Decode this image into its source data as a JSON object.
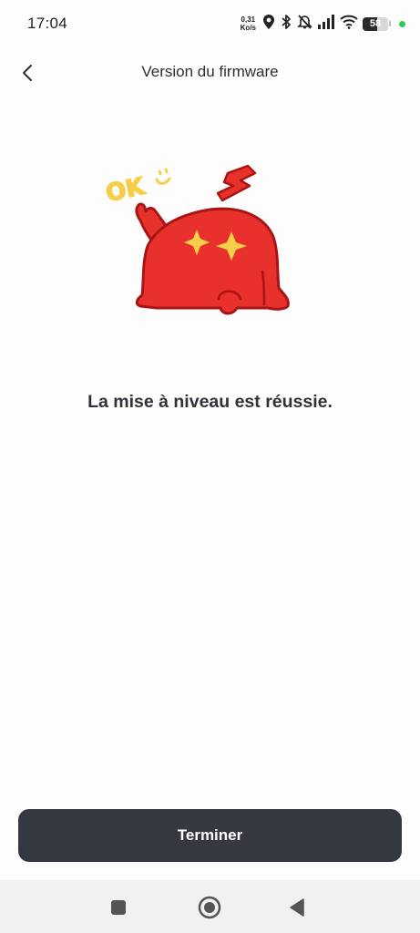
{
  "status_bar": {
    "time": "17:04",
    "net_speed_value": "0,31",
    "net_speed_unit": "Ko/s",
    "battery_level": "58",
    "icons": [
      "location-icon",
      "bluetooth-icon",
      "bell-muted-icon",
      "signal-icon",
      "wifi-icon",
      "battery-icon"
    ]
  },
  "header": {
    "title": "Version du firmware",
    "back_icon": "chevron-left-icon"
  },
  "illustration": {
    "ok_text": "OK",
    "accent": "#e8302c",
    "star_color": "#f6cf4a"
  },
  "main": {
    "message": "La mise à niveau est réussie."
  },
  "footer": {
    "finish_label": "Terminer"
  },
  "nav_bar": {
    "icons": [
      "recents-square-icon",
      "home-circle-icon",
      "back-triangle-icon"
    ]
  }
}
